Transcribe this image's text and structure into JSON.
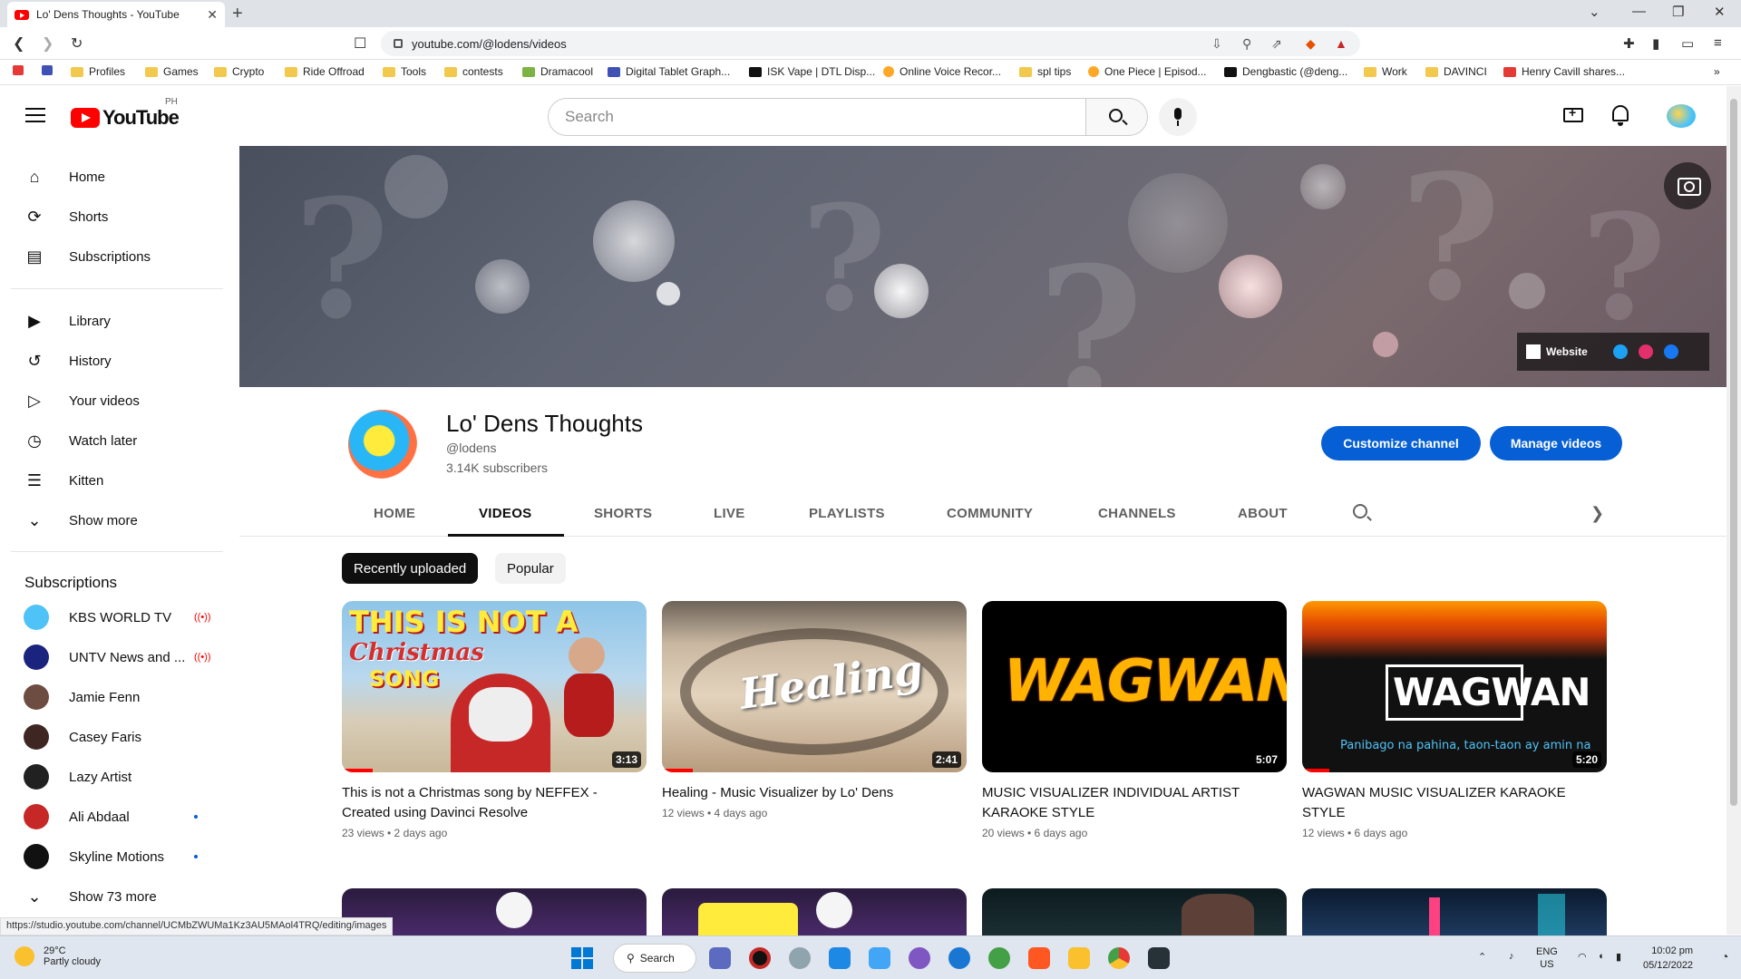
{
  "browser": {
    "tab_title": "Lo' Dens Thoughts - YouTube",
    "url": "youtube.com/@lodens/videos",
    "bookmarks": [
      "Profiles",
      "Games",
      "Crypto",
      "Ride Offroad",
      "Tools",
      "contests",
      "Dramacool",
      "Digital Tablet Graph...",
      "ISK Vape | DTL Disp...",
      "Online Voice Recor...",
      "spl tips",
      "One Piece | Episod...",
      "Dengbastic (@deng...",
      "Work",
      "DAVINCI",
      "Henry Cavill shares..."
    ]
  },
  "header": {
    "logo": "YouTube",
    "country": "PH",
    "search_placeholder": "Search"
  },
  "sidebar": {
    "main": [
      "Home",
      "Shorts",
      "Subscriptions"
    ],
    "library": [
      "Library",
      "History",
      "Your videos",
      "Watch later",
      "Kitten",
      "Show more"
    ],
    "subscriptions_title": "Subscriptions",
    "subscriptions": [
      {
        "name": "KBS WORLD TV",
        "status": "live"
      },
      {
        "name": "UNTV News and ...",
        "status": "live"
      },
      {
        "name": "Jamie Fenn",
        "status": ""
      },
      {
        "name": "Casey Faris",
        "status": ""
      },
      {
        "name": "Lazy Artist",
        "status": ""
      },
      {
        "name": "Ali Abdaal",
        "status": "new"
      },
      {
        "name": "Skyline Motions",
        "status": "new"
      }
    ],
    "show_more_subs": "Show 73 more"
  },
  "banner": {
    "website_label": "Website"
  },
  "channel": {
    "name": "Lo' Dens Thoughts",
    "handle": "@lodens",
    "subscribers": "3.14K subscribers",
    "customize_label": "Customize channel",
    "manage_label": "Manage videos",
    "tabs": [
      "HOME",
      "VIDEOS",
      "SHORTS",
      "LIVE",
      "PLAYLISTS",
      "COMMUNITY",
      "CHANNELS",
      "ABOUT"
    ],
    "active_tab": "VIDEOS"
  },
  "chips": [
    "Recently uploaded",
    "Popular"
  ],
  "videos": [
    {
      "title": "This is not a Christmas song by NEFFEX - Created using Davinci Resolve",
      "meta": "23 views • 2 days ago",
      "duration": "3:13",
      "thumb_text_1": "THIS IS NOT A",
      "thumb_text_2": "Christmas",
      "thumb_text_3": "SONG"
    },
    {
      "title": "Healing - Music Visualizer by Lo' Dens",
      "meta": "12 views • 4 days ago",
      "duration": "2:41",
      "thumb_text_1": "Healing"
    },
    {
      "title": "MUSIC VISUALIZER INDIVIDUAL ARTIST KARAOKE STYLE",
      "meta": "20 views • 6 days ago",
      "duration": "5:07",
      "thumb_text_1": "WAGWAN"
    },
    {
      "title": "WAGWAN MUSIC VISUALIZER KARAOKE STYLE",
      "meta": "12 views • 6 days ago",
      "duration": "5:20",
      "thumb_text_1": "WAGWAN",
      "thumb_text_2": "Panibago na pahina, taon-taon ay amin na"
    }
  ],
  "status_url": "https://studio.youtube.com/channel/UCMbZWUMa1Kz3AU5MAol4TRQ/editing/images",
  "taskbar": {
    "temp": "29°C",
    "weather": "Partly cloudy",
    "search_label": "Search",
    "lang_1": "ENG",
    "lang_2": "US",
    "time": "10:02 pm",
    "date": "05/12/2022"
  },
  "colors": {
    "accent": "#065fd4",
    "youtube_red": "#ff0000"
  }
}
